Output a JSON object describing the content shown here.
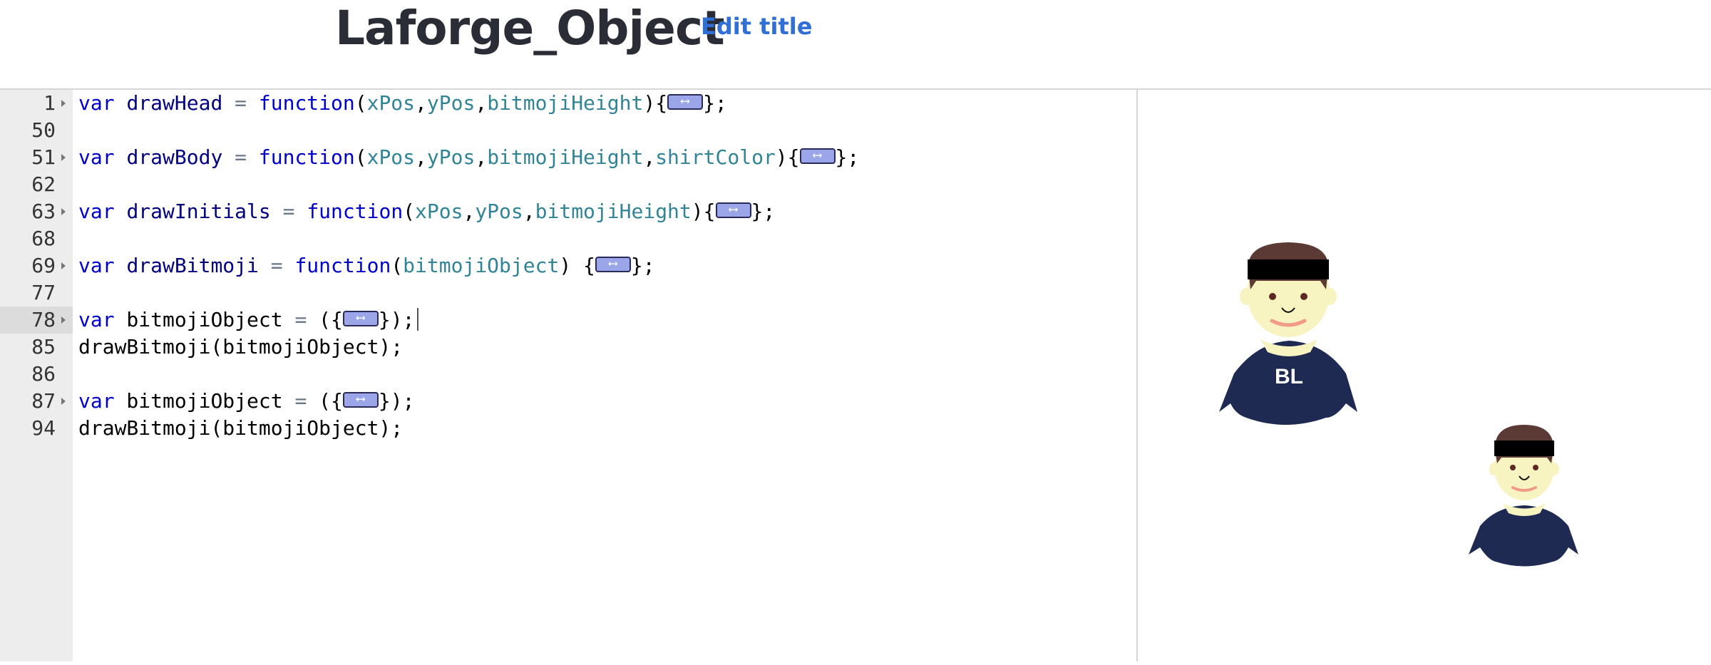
{
  "header": {
    "title": "Laforge_Object",
    "edit_title_label": "Edit title"
  },
  "editor": {
    "active_line": "78",
    "lines": [
      {
        "num": "1",
        "fold": true,
        "tokens": [
          [
            "kw",
            "var"
          ],
          [
            "plain",
            " "
          ],
          [
            "fn",
            "drawHead"
          ],
          [
            "plain",
            " "
          ],
          [
            "op",
            "="
          ],
          [
            "plain",
            " "
          ],
          [
            "kw",
            "function"
          ],
          [
            "plain",
            "("
          ],
          [
            "pr",
            "xPos"
          ],
          [
            "plain",
            ","
          ],
          [
            "pr",
            "yPos"
          ],
          [
            "plain",
            ","
          ],
          [
            "pr",
            "bitmojiHeight"
          ],
          [
            "plain",
            ")"
          ],
          [
            "plain",
            "{"
          ],
          [
            "fold-widget",
            ""
          ],
          [
            "plain",
            "};"
          ]
        ]
      },
      {
        "num": "50",
        "fold": false,
        "tokens": []
      },
      {
        "num": "51",
        "fold": true,
        "tokens": [
          [
            "kw",
            "var"
          ],
          [
            "plain",
            " "
          ],
          [
            "fn",
            "drawBody"
          ],
          [
            "plain",
            " "
          ],
          [
            "op",
            "="
          ],
          [
            "plain",
            " "
          ],
          [
            "kw",
            "function"
          ],
          [
            "plain",
            "("
          ],
          [
            "pr",
            "xPos"
          ],
          [
            "plain",
            ","
          ],
          [
            "pr",
            "yPos"
          ],
          [
            "plain",
            ","
          ],
          [
            "pr",
            "bitmojiHeight"
          ],
          [
            "plain",
            ","
          ],
          [
            "pr",
            "shirtColor"
          ],
          [
            "plain",
            ")"
          ],
          [
            "plain",
            "{"
          ],
          [
            "fold-widget",
            ""
          ],
          [
            "plain",
            "};"
          ]
        ]
      },
      {
        "num": "62",
        "fold": false,
        "tokens": []
      },
      {
        "num": "63",
        "fold": true,
        "tokens": [
          [
            "kw",
            "var"
          ],
          [
            "plain",
            " "
          ],
          [
            "fn",
            "drawInitials"
          ],
          [
            "plain",
            " "
          ],
          [
            "op",
            "="
          ],
          [
            "plain",
            " "
          ],
          [
            "kw",
            "function"
          ],
          [
            "plain",
            "("
          ],
          [
            "pr",
            "xPos"
          ],
          [
            "plain",
            ","
          ],
          [
            "pr",
            "yPos"
          ],
          [
            "plain",
            ","
          ],
          [
            "pr",
            "bitmojiHeight"
          ],
          [
            "plain",
            ")"
          ],
          [
            "plain",
            "{"
          ],
          [
            "fold-widget",
            ""
          ],
          [
            "plain",
            "};"
          ]
        ]
      },
      {
        "num": "68",
        "fold": false,
        "tokens": []
      },
      {
        "num": "69",
        "fold": true,
        "tokens": [
          [
            "kw",
            "var"
          ],
          [
            "plain",
            " "
          ],
          [
            "fn",
            "drawBitmoji"
          ],
          [
            "plain",
            " "
          ],
          [
            "op",
            "="
          ],
          [
            "plain",
            " "
          ],
          [
            "kw",
            "function"
          ],
          [
            "plain",
            "("
          ],
          [
            "pr",
            "bitmojiObject"
          ],
          [
            "plain",
            ")"
          ],
          [
            "plain",
            " {"
          ],
          [
            "fold-widget",
            ""
          ],
          [
            "plain",
            "};"
          ]
        ]
      },
      {
        "num": "77",
        "fold": false,
        "tokens": []
      },
      {
        "num": "78",
        "fold": true,
        "cursor": true,
        "tokens": [
          [
            "kw",
            "var"
          ],
          [
            "plain",
            " bitmojiObject "
          ],
          [
            "op",
            "="
          ],
          [
            "plain",
            " ({"
          ],
          [
            "fold-widget",
            ""
          ],
          [
            "plain",
            "});"
          ]
        ]
      },
      {
        "num": "85",
        "fold": false,
        "tokens": [
          [
            "plain",
            "drawBitmoji(bitmojiObject);"
          ]
        ]
      },
      {
        "num": "86",
        "fold": false,
        "tokens": []
      },
      {
        "num": "87",
        "fold": true,
        "tokens": [
          [
            "kw",
            "var"
          ],
          [
            "plain",
            " bitmojiObject "
          ],
          [
            "op",
            "="
          ],
          [
            "plain",
            " ({"
          ],
          [
            "fold-widget",
            ""
          ],
          [
            "plain",
            "});"
          ]
        ]
      },
      {
        "num": "94",
        "fold": false,
        "tokens": [
          [
            "plain",
            "drawBitmoji(bitmojiObject);"
          ]
        ]
      }
    ]
  },
  "canvas": {
    "bitmojis": [
      {
        "name": "bitmoji-large",
        "initials": "BL",
        "shirt_color": "#1f2a52",
        "skin_color": "#f7f4c2",
        "hair_color": "#5b3a35",
        "band_color": "#000000"
      },
      {
        "name": "bitmoji-small",
        "initials": "",
        "shirt_color": "#1f2a52",
        "skin_color": "#f7f4c2",
        "hair_color": "#5b3a35",
        "band_color": "#000000"
      }
    ]
  },
  "colors": {
    "keyword": "#0000cc",
    "function_name": "#000080",
    "parameter": "#318495",
    "gutter": "#ededed",
    "accent_link": "#2f6fd6"
  }
}
